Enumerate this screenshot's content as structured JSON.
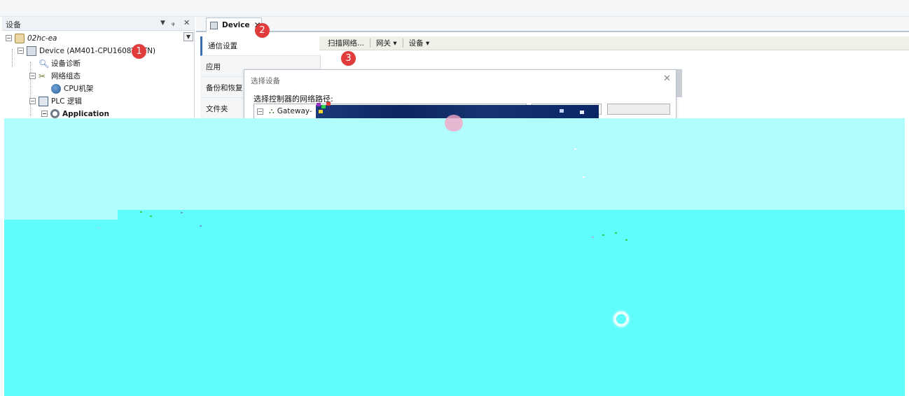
{
  "left_panel": {
    "title": "设备",
    "tree": [
      {
        "label": "02hc-ea"
      },
      {
        "label": "Device (AM401-CPU1608TP/TN)"
      },
      {
        "label": "设备诊断"
      },
      {
        "label": "网络组态"
      },
      {
        "label": "CPU机架"
      },
      {
        "label": "PLC 逻辑"
      },
      {
        "label": "Application"
      }
    ]
  },
  "editor": {
    "tab_label": "Device",
    "side_menu": [
      "通信设置",
      "应用",
      "备份和恢复",
      "文件夹"
    ],
    "toolbar": [
      "扫描网络...",
      "网关 ▾",
      "设备 ▾"
    ]
  },
  "dialog": {
    "title": "选择设备",
    "path_label": "选择控制器的网络路径:",
    "gateway_label": "Gateway-"
  },
  "badges": [
    "1",
    "2",
    "3"
  ],
  "colors": {
    "badge": "#e23b3b",
    "cyan_light": "#b1fdfd",
    "cyan": "#5ffcfc",
    "accent": "#3a6db5"
  }
}
